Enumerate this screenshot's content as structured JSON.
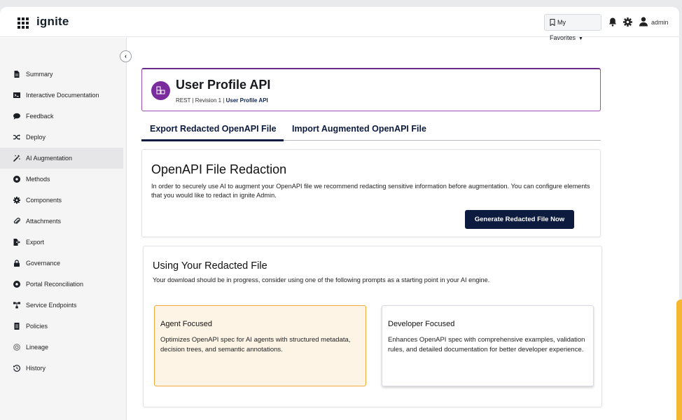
{
  "header": {
    "brand": "ignite",
    "favorites_label": "My Favorites",
    "user_label": "admin"
  },
  "sidebar": {
    "items": [
      {
        "label": "Summary",
        "icon": "file-icon"
      },
      {
        "label": "Interactive Documentation",
        "icon": "terminal-icon"
      },
      {
        "label": "Feedback",
        "icon": "comment-icon"
      },
      {
        "label": "Deploy",
        "icon": "shuffle-icon"
      },
      {
        "label": "AI Augmentation",
        "icon": "magic-wand-icon"
      },
      {
        "label": "Methods",
        "icon": "circle-dot-icon"
      },
      {
        "label": "Components",
        "icon": "cog-icon"
      },
      {
        "label": "Attachments",
        "icon": "paperclip-icon"
      },
      {
        "label": "Export",
        "icon": "export-icon"
      },
      {
        "label": "Governance",
        "icon": "lock-icon"
      },
      {
        "label": "Portal Reconciliation",
        "icon": "circle-dot-icon"
      },
      {
        "label": "Service Endpoints",
        "icon": "network-icon"
      },
      {
        "label": "Policies",
        "icon": "document-icon"
      },
      {
        "label": "Lineage",
        "icon": "lineage-icon"
      },
      {
        "label": "History",
        "icon": "history-icon"
      }
    ],
    "active_item": "AI Augmentation"
  },
  "api": {
    "title": "User Profile API",
    "meta_prefix": "REST | Revision 1 | ",
    "meta_name": "User Profile API"
  },
  "tabs": [
    {
      "label": "Export Redacted OpenAPI File",
      "active": true
    },
    {
      "label": "Import Augmented OpenAPI File",
      "active": false
    }
  ],
  "redaction": {
    "title": "OpenAPI File Redaction",
    "description": "In order to securely use AI to augment your OpenAPI file we recommend redacting sensitive information before augmentation. You can configure elements that you would like to redact in ignite Admin.",
    "button_label": "Generate Redacted File Now"
  },
  "using": {
    "title": "Using Your Redacted File",
    "subtitle": "Your download should be in progress, consider using one of the following prompts as a starting point in your AI engine.",
    "choices": [
      {
        "title": "Agent Focused",
        "description": "Optimizes OpenAPI spec for AI agents with structured metadata, decision trees, and semantic annotations.",
        "selected": true
      },
      {
        "title": "Developer Focused",
        "description": "Enhances OpenAPI spec with comprehensive examples, validation rules, and detailed documentation for better developer experience.",
        "selected": false
      }
    ]
  },
  "colors": {
    "navy": "#0d1b3e",
    "purple": "#7b2c9c",
    "agent_highlight": "#f2a93b",
    "agent_bg": "#fdf4e6"
  }
}
